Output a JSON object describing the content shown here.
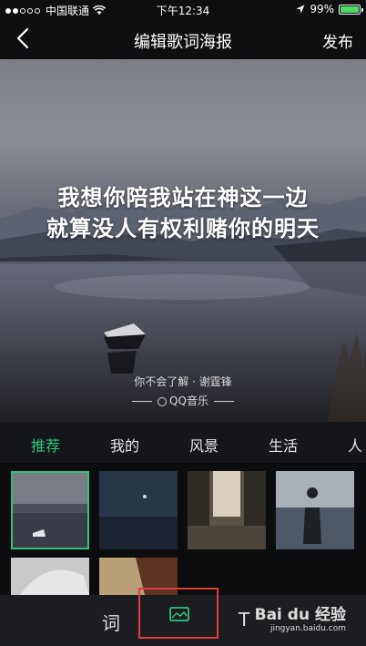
{
  "status_bar": {
    "carrier": "中国联通",
    "time": "下午12:34",
    "battery": "99%"
  },
  "nav": {
    "title": "编辑歌词海报",
    "publish_label": "发布"
  },
  "poster": {
    "lyrics": [
      "我想你陪我站在神这一边",
      "就算没人有权利赌你的明天"
    ],
    "credit": "你不会了解 · 谢霆锋",
    "brand": "QQ音乐"
  },
  "tabs": [
    "推荐",
    "我的",
    "风景",
    "生活",
    "人"
  ],
  "active_tab_index": 0,
  "toolbar": {
    "lyrics_label": "词",
    "text_label": "T"
  },
  "watermark": {
    "brand": "Bai du 经验",
    "url": "jingyan.baidu.com"
  },
  "colors": {
    "accent": "#31c27c",
    "highlight": "#e23b3b"
  },
  "icons": {
    "back": "back-chevron-icon",
    "image": "image-icon",
    "wifi": "wifi-icon",
    "location": "location-arrow-icon",
    "battery": "battery-icon",
    "qq_music": "qq-music-logo-icon"
  }
}
